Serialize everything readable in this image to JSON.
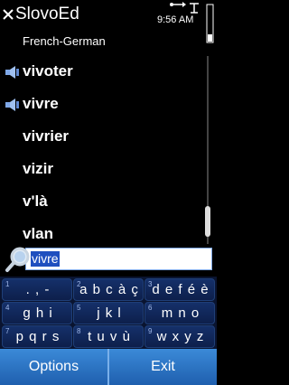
{
  "app": {
    "title": "SlovoEd",
    "clock": "9:56 AM"
  },
  "dictionary": {
    "name": "French-German"
  },
  "words": [
    {
      "text": "vivoter",
      "has_audio": true
    },
    {
      "text": "vivre",
      "has_audio": true
    },
    {
      "text": "vivrier",
      "has_audio": false
    },
    {
      "text": "vizir",
      "has_audio": false
    },
    {
      "text": "v'là",
      "has_audio": false
    },
    {
      "text": "vlan",
      "has_audio": false
    }
  ],
  "search": {
    "value": "vivre"
  },
  "keypad": [
    {
      "num": "1",
      "chars": ". , -"
    },
    {
      "num": "2",
      "chars": "a b c à ç"
    },
    {
      "num": "3",
      "chars": "d e f é è"
    },
    {
      "num": "4",
      "chars": "g h i"
    },
    {
      "num": "5",
      "chars": "j k l"
    },
    {
      "num": "6",
      "chars": "m n o"
    },
    {
      "num": "7",
      "chars": "p q r s"
    },
    {
      "num": "8",
      "chars": "t u v ù"
    },
    {
      "num": "9",
      "chars": "w x y z"
    }
  ],
  "softkeys": {
    "left": "Options",
    "right": "Exit"
  },
  "colors": {
    "softkey_bar": "#2f7bd0",
    "selection": "#1f4fbf",
    "keypad_bg": "#0a1430"
  }
}
